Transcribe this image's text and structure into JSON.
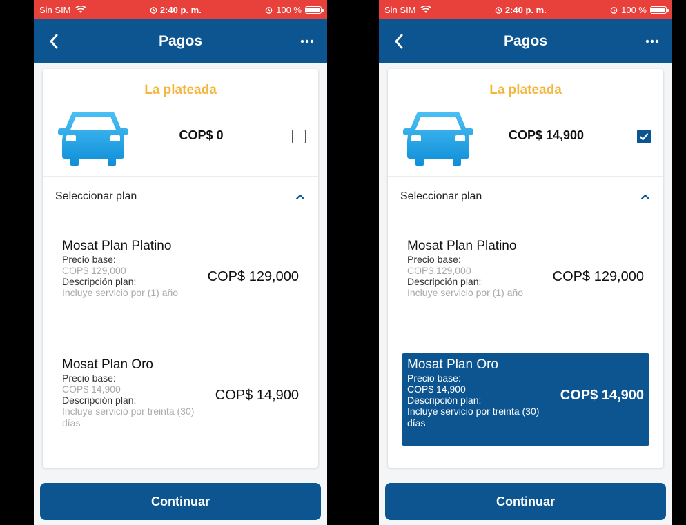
{
  "screens": [
    {
      "status": {
        "carrier": "Sin SIM",
        "time": "2:40 p. m.",
        "battery": "100 %"
      },
      "nav": {
        "title": "Pagos"
      },
      "vehicle": {
        "name": "La plateada",
        "price": "COP$ 0",
        "checked": false
      },
      "select_plan_label": "Seleccionar plan",
      "plans": [
        {
          "name": "Mosat Plan Platino",
          "base_label": "Precio base:",
          "base_value": "COP$ 129,000",
          "desc_label": "Descripción plan:",
          "desc_value": "Incluye servicio por (1) año",
          "price": "COP$ 129,000",
          "selected": false
        },
        {
          "name": "Mosat Plan Oro",
          "base_label": "Precio base:",
          "base_value": "COP$ 14,900",
          "desc_label": "Descripción plan:",
          "desc_value": "Incluye servicio por treinta (30) días",
          "price": "COP$ 14,900",
          "selected": false
        }
      ],
      "continue_label": "Continuar"
    },
    {
      "status": {
        "carrier": "Sin SIM",
        "time": "2:40 p. m.",
        "battery": "100 %"
      },
      "nav": {
        "title": "Pagos"
      },
      "vehicle": {
        "name": "La plateada",
        "price": "COP$ 14,900",
        "checked": true
      },
      "select_plan_label": "Seleccionar plan",
      "plans": [
        {
          "name": "Mosat Plan Platino",
          "base_label": "Precio base:",
          "base_value": "COP$ 129,000",
          "desc_label": "Descripción plan:",
          "desc_value": "Incluye servicio por (1) año",
          "price": "COP$ 129,000",
          "selected": false
        },
        {
          "name": "Mosat Plan Oro",
          "base_label": "Precio base:",
          "base_value": "COP$ 14,900",
          "desc_label": "Descripción plan:",
          "desc_value": "Incluye servicio por treinta (30) días",
          "price": "COP$ 14,900",
          "selected": true
        }
      ],
      "continue_label": "Continuar"
    }
  ],
  "colors": {
    "status_bar": "#e8413c",
    "primary": "#0c5591",
    "vehicle_name": "#f4b63f",
    "car_icon": "#1aa3e8"
  },
  "icons": [
    "wifi-icon",
    "alarm-icon",
    "battery-icon",
    "back-chevron-icon",
    "more-icon",
    "car-icon",
    "checkbox-icon",
    "chevron-up-icon"
  ]
}
